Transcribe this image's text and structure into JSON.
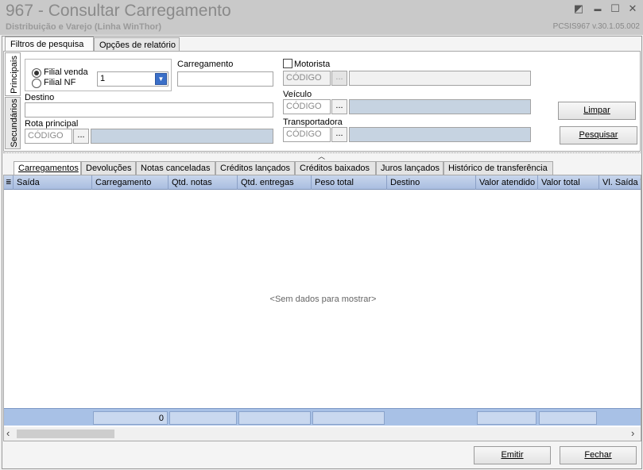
{
  "window": {
    "title": "967 - Consultar Carregamento",
    "subtitle": "Distribuição e Varejo (Linha WinThor)",
    "version": "PCSIS967  v.30.1.05.002",
    "controls": {
      "restore": "◩",
      "minimize": "▬",
      "maximize": "☐",
      "close": "✕"
    }
  },
  "top_tabs": [
    {
      "label": "Filtros de pesquisa",
      "active": true
    },
    {
      "label": "Opções de relatório",
      "active": false
    }
  ],
  "side_tabs": [
    {
      "label": "Principais",
      "active": true
    },
    {
      "label": "Secundários",
      "active": false
    }
  ],
  "filters": {
    "filial_venda_label": "Filial venda",
    "filial_nf_label": "Filial NF",
    "filial_value": "1",
    "carregamento_label": "Carregamento",
    "carregamento_value": "",
    "motorista_label": "Motorista",
    "motorista_code_placeholder": "CÓDIGO",
    "destino_label": "Destino",
    "destino_value": "",
    "veiculo_label": "Veículo",
    "veiculo_code_placeholder": "CÓDIGO",
    "rota_label": "Rota principal",
    "rota_code_placeholder": "CÓDIGO",
    "transportadora_label": "Transportadora",
    "transportadora_code_placeholder": "CÓDIGO",
    "browse_label": "...",
    "limpar_label": "Limpar",
    "pesquisar_label": "Pesquisar"
  },
  "result_tabs": [
    {
      "label": "Carregamentos",
      "active": true
    },
    {
      "label": "Devoluções",
      "active": false
    },
    {
      "label": "Notas canceladas",
      "active": false
    },
    {
      "label": "Créditos lançados",
      "active": false
    },
    {
      "label": "Créditos baixados",
      "active": false
    },
    {
      "label": "Juros lançados",
      "active": false
    },
    {
      "label": "Histórico de transferência",
      "active": false
    }
  ],
  "grid": {
    "columns": [
      "Saída",
      "Carregamento",
      "Qtd. notas",
      "Qtd. entregas",
      "Peso total",
      "Destino",
      "Valor atendido",
      "Valor total",
      "Vl. Saída Tr"
    ],
    "empty_message": "<Sem dados para mostrar>",
    "footer_carregamento_total": "0",
    "scroll_left": "‹",
    "scroll_right": "›"
  },
  "buttons": {
    "emitir": "Emitir",
    "fechar": "Fechar"
  },
  "colors": {
    "titlebar": "#c9c9c9",
    "grid_header": "#a9bde0",
    "grid_footer": "#a8c1e6"
  }
}
